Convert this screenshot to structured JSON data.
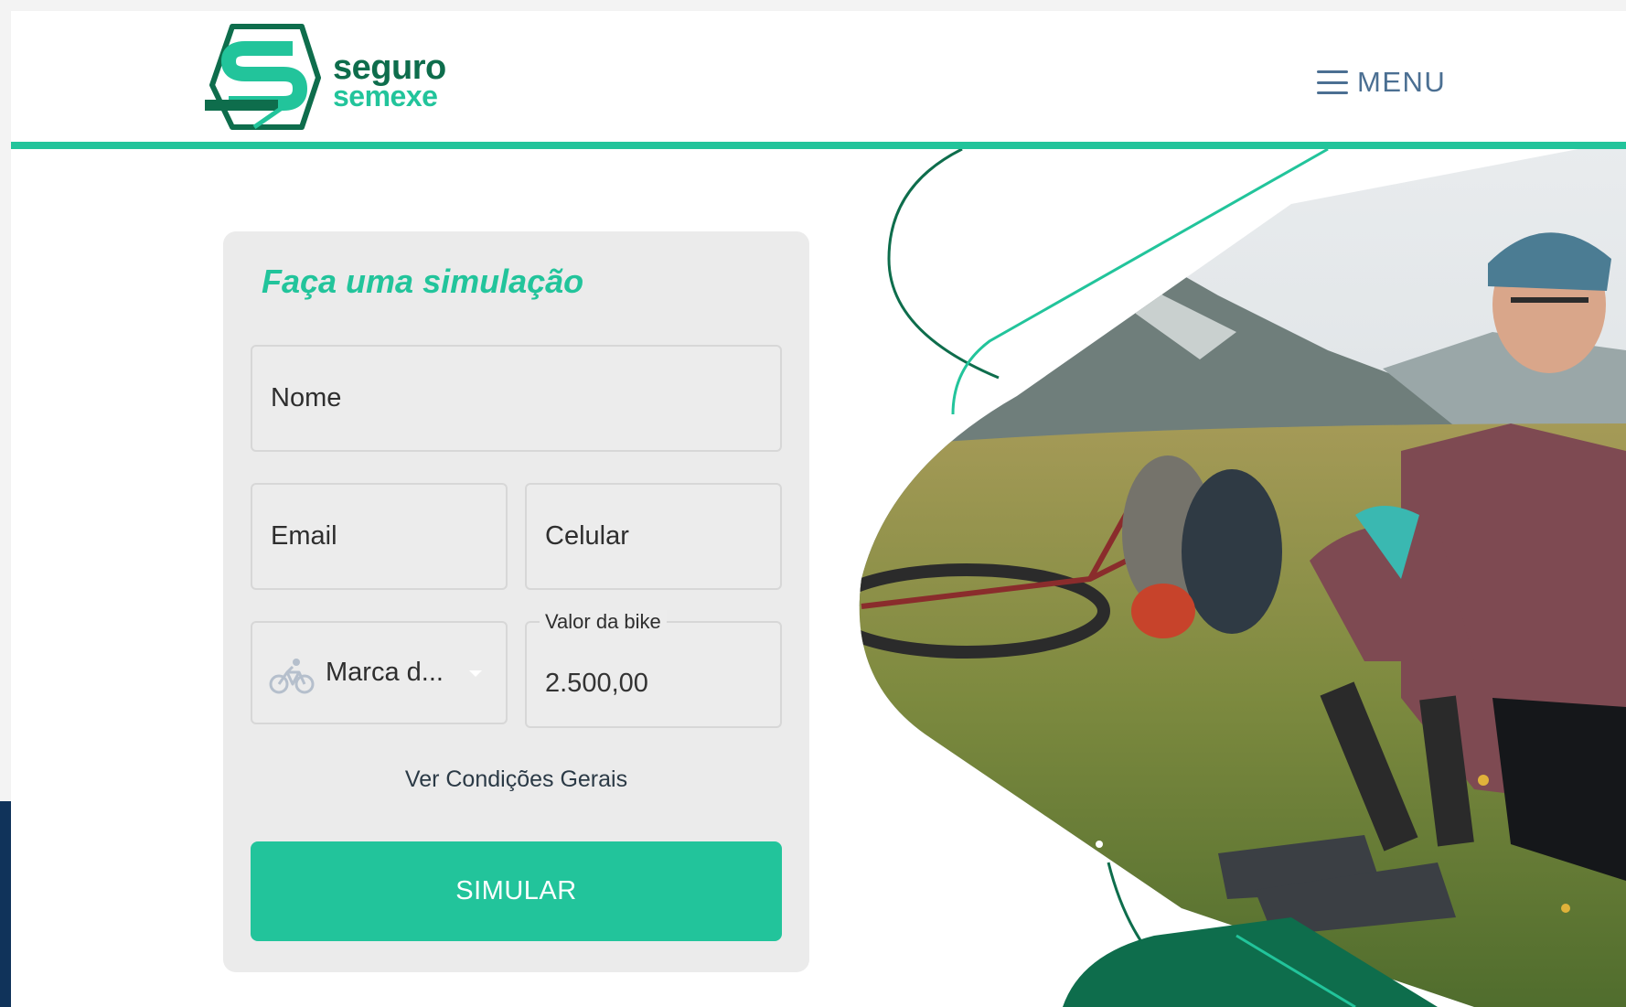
{
  "brand": {
    "line1": "seguro",
    "line2": "semexe",
    "colors": {
      "dark_green": "#0e6d4c",
      "accent_green": "#22c49b",
      "menu_blue": "#4b6f92"
    }
  },
  "header": {
    "menu_icon": "hamburger-icon",
    "menu_label": "MENU"
  },
  "form": {
    "title": "Faça uma simulação",
    "nome_placeholder": "Nome",
    "email_placeholder": "Email",
    "celular_placeholder": "Celular",
    "marca": {
      "icon": "bicycle-icon",
      "selected": "Marca d..."
    },
    "valor": {
      "label": "Valor da bike",
      "value": "2.500,00"
    },
    "conditions_link": "Ver Condições Gerais",
    "submit_label": "SIMULAR"
  }
}
